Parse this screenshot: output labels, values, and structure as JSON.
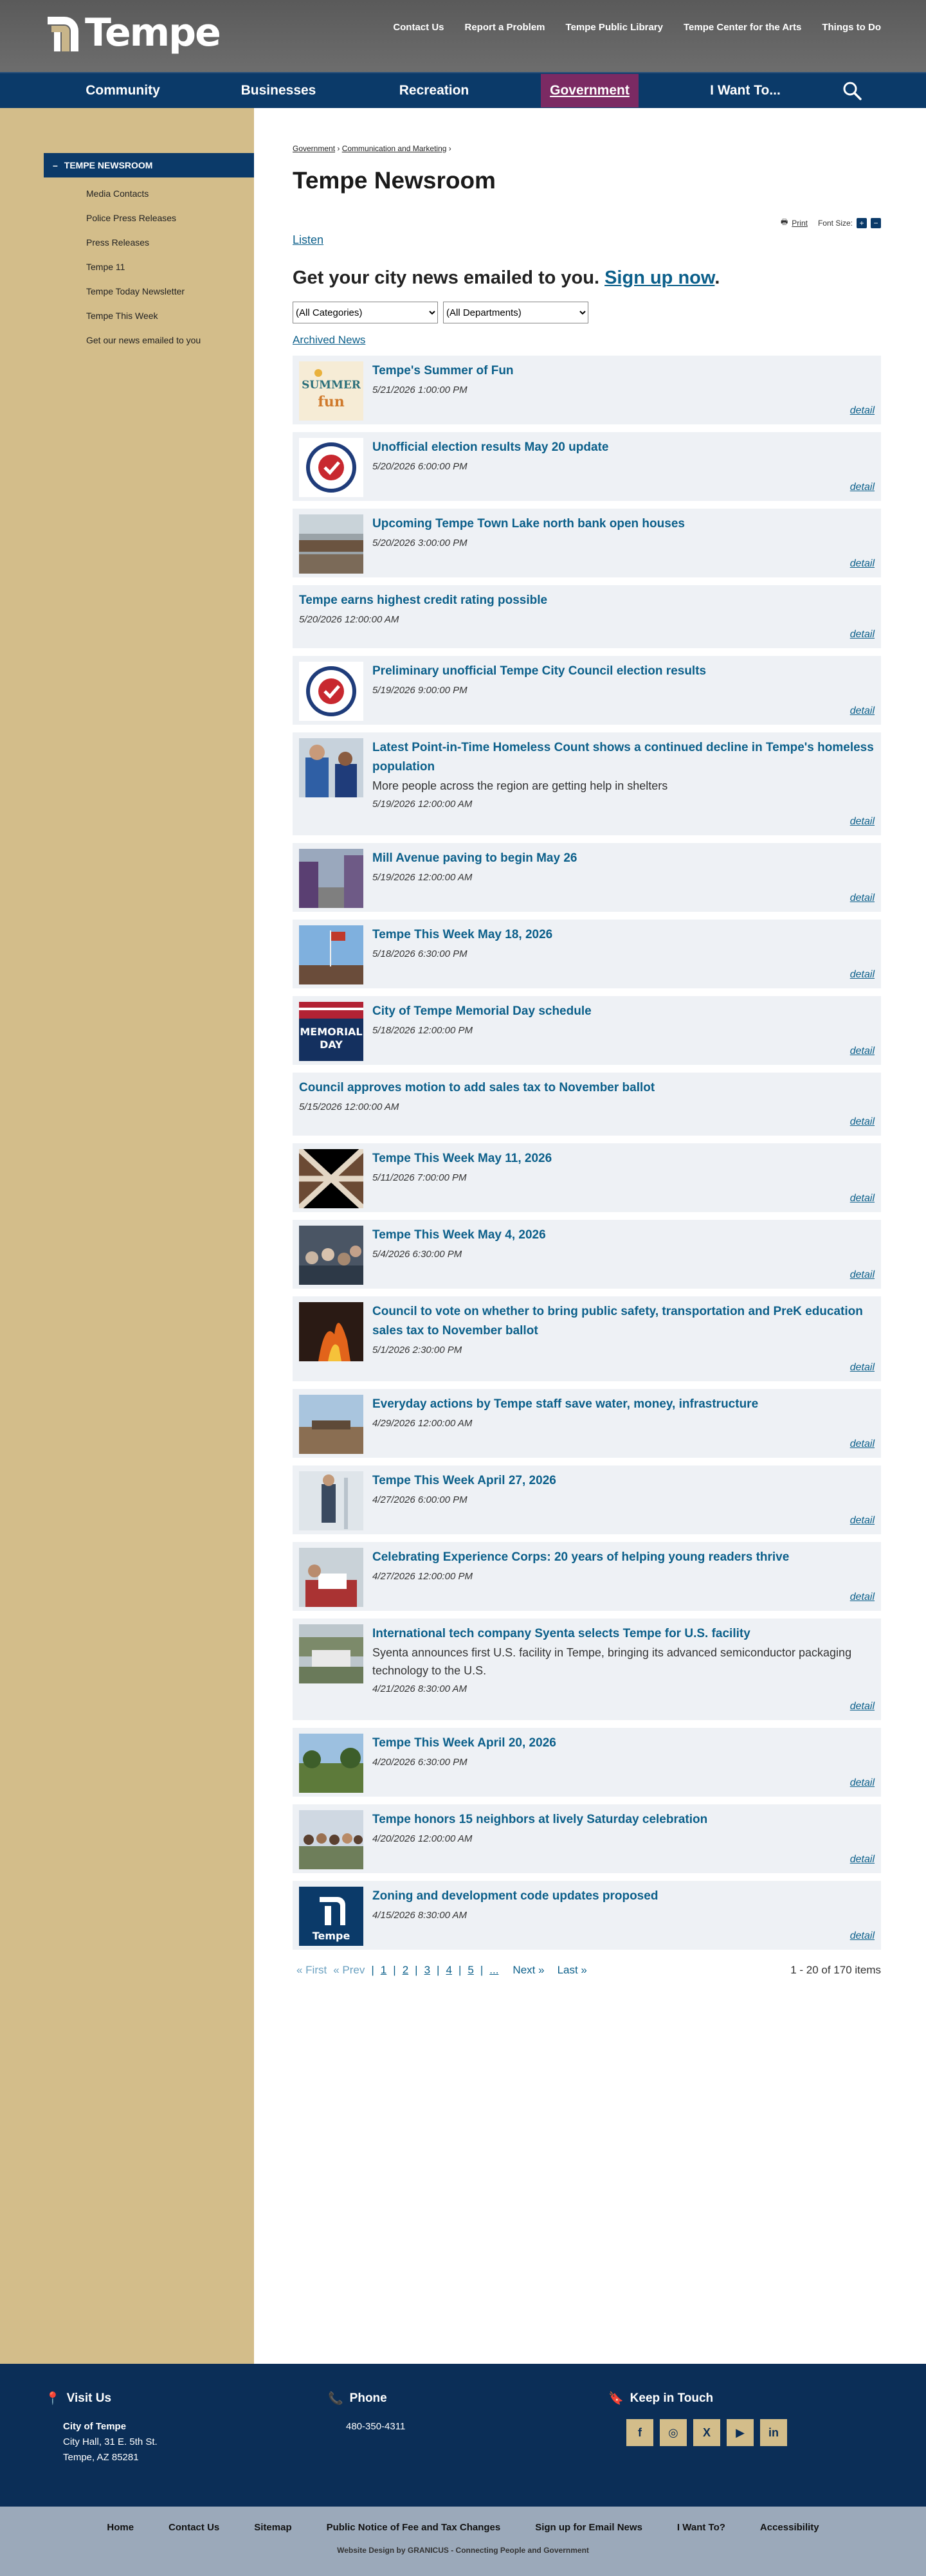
{
  "header": {
    "logo_text": "Tempe",
    "utility": [
      "Contact Us",
      "Report a Problem",
      "Tempe Public Library",
      "Tempe Center for the Arts",
      "Things to Do"
    ],
    "nav": [
      "Community",
      "Businesses",
      "Recreation",
      "Government",
      "I Want To..."
    ],
    "active_nav": "Government"
  },
  "sidebar": {
    "heading": "TEMPE NEWSROOM",
    "items": [
      "Media Contacts",
      "Police Press Releases",
      "Press Releases",
      "Tempe 11",
      "Tempe Today Newsletter",
      "Tempe This Week",
      "Get our news emailed to you"
    ]
  },
  "page": {
    "breadcrumb": [
      "Government",
      "Communication and Marketing"
    ],
    "title": "Tempe Newsroom",
    "print": "Print",
    "font_size": "Font Size:",
    "listen": "Listen",
    "signup_text": "Get your city news emailed to you. ",
    "signup_link": "Sign up now",
    "signup_end": ".",
    "filter_categories": "(All Categories)",
    "filter_departments": "(All Departments)",
    "archived": "Archived News",
    "detail": "detail"
  },
  "news": [
    {
      "title": "Tempe's Summer of Fun",
      "date": "5/21/2026 1:00:00 PM",
      "img": "summer"
    },
    {
      "title": "Unofficial election results May 20 update",
      "date": "5/20/2026 6:00:00 PM",
      "img": "election"
    },
    {
      "title": "Upcoming Tempe Town Lake north bank open houses",
      "date": "5/20/2026 3:00:00 PM",
      "img": "lake"
    },
    {
      "title": "Tempe earns highest credit rating possible",
      "date": "5/20/2026 12:00:00 AM",
      "img": ""
    },
    {
      "title": "Preliminary unofficial Tempe City Council election results",
      "date": "5/19/2026 9:00:00 PM",
      "img": "election"
    },
    {
      "title": "Latest Point-in-Time Homeless Count shows a continued decline in Tempe's homeless population",
      "subtitle": "More people across the region are getting help in shelters",
      "date": "5/19/2026 12:00:00 AM",
      "img": "people"
    },
    {
      "title": "Mill Avenue paving to begin May 26",
      "date": "5/19/2026 12:00:00 AM",
      "img": "street"
    },
    {
      "title": "Tempe This Week May 18, 2026",
      "date": "5/18/2026 6:30:00 PM",
      "img": "flag"
    },
    {
      "title": "City of Tempe Memorial Day schedule",
      "date": "5/18/2026 12:00:00 PM",
      "img": "memorial"
    },
    {
      "title": "Council approves motion to add sales tax to November ballot",
      "date": "5/15/2026 12:00:00 AM",
      "img": ""
    },
    {
      "title": "Tempe This Week May 11, 2026",
      "date": "5/11/2026 7:00:00 PM",
      "img": "arch"
    },
    {
      "title": "Tempe This Week May 4, 2026",
      "date": "5/4/2026 6:30:00 PM",
      "img": "crowd"
    },
    {
      "title": "Council to vote on whether to bring public safety, transportation and PreK education sales tax to November ballot",
      "date": "5/1/2026 2:30:00 PM",
      "img": "fire"
    },
    {
      "title": "Everyday actions by Tempe staff save water, money, infrastructure",
      "date": "4/29/2026 12:00:00 AM",
      "img": "water"
    },
    {
      "title": "Tempe This Week April 27, 2026",
      "date": "4/27/2026 6:00:00 PM",
      "img": "bright"
    },
    {
      "title": "Celebrating Experience Corps: 20 years of helping young readers thrive",
      "date": "4/27/2026 12:00:00 PM",
      "img": "reading"
    },
    {
      "title": "International tech company Syenta selects Tempe for U.S. facility",
      "subtitle": "Syenta announces first U.S. facility in Tempe, bringing its advanced semiconductor packaging technology to the U.S.",
      "date": "4/21/2026 8:30:00 AM",
      "img": "aerial"
    },
    {
      "title": "Tempe This Week April 20, 2026",
      "date": "4/20/2026 6:30:00 PM",
      "img": "park"
    },
    {
      "title": "Tempe honors 15 neighbors at lively Saturday celebration",
      "date": "4/20/2026 12:00:00 AM",
      "img": "group"
    },
    {
      "title": "Zoning and development code updates proposed",
      "date": "4/15/2026 8:30:00 AM",
      "img": "tempe"
    }
  ],
  "pager": {
    "first": "« First",
    "prev": "« Prev",
    "pages": [
      "1",
      "2",
      "3",
      "4",
      "5",
      "..."
    ],
    "next": "Next »",
    "last": "Last »",
    "count": "1 - 20 of 170 items"
  },
  "footer": {
    "visit_title": "Visit Us",
    "visit_name": "City of Tempe",
    "visit_addr1": "City Hall, 31 E. 5th St.",
    "visit_addr2": "Tempe, AZ 85281",
    "phone_title": "Phone",
    "phone": "480-350-4311",
    "touch_title": "Keep in Touch",
    "bottom_links": [
      "Home",
      "Contact Us",
      "Sitemap",
      "Public Notice of Fee and Tax Changes",
      "Sign up for Email News",
      "I Want To?",
      "Accessibility"
    ],
    "credit": "Website Design by GRANICUS - Connecting People and Government"
  }
}
